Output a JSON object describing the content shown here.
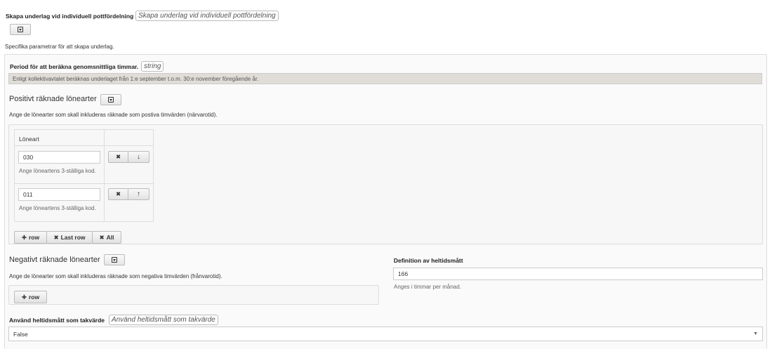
{
  "underlag": {
    "label": "Skapa underlag vid individuell pottfördelning",
    "badge": "Skapa underlag vid individuell pottfördelning",
    "description": "Specifika parametrar för att skapa underlag."
  },
  "period": {
    "label": "Period för att beräkna genomsnittliga timmar.",
    "badge": "string",
    "info": "Enligt kollektivavtalet beräknas underlaget från 1:e september t.o.m. 30:e november föregående år."
  },
  "positive": {
    "title": "Positivt räknade lönearter",
    "description": "Ange de lönearter som skall inkluderas räknade som postiva timvärden (närvarotid).",
    "column_header": "Löneart",
    "rows": [
      {
        "value": "030",
        "help": "Ange löneartens 3-ställiga kod."
      },
      {
        "value": "011",
        "help": "Ange löneartens 3-ställiga kod."
      }
    ],
    "add_row": "row",
    "remove_last": "Last row",
    "remove_all": "All"
  },
  "negative": {
    "title": "Negativt räknade lönearter",
    "description": "Ange de lönearter som skall inkluderas räknade som negativa timvärden (frånvarotid).",
    "add_row": "row"
  },
  "heltid": {
    "label": "Definition av heltidsmått",
    "value": "166",
    "help": "Anges i timmar per månad."
  },
  "takvarde": {
    "label": "Använd heltidsmått som takvärde",
    "badge": "Använd heltidsmått som takvärde",
    "selected": "False"
  }
}
